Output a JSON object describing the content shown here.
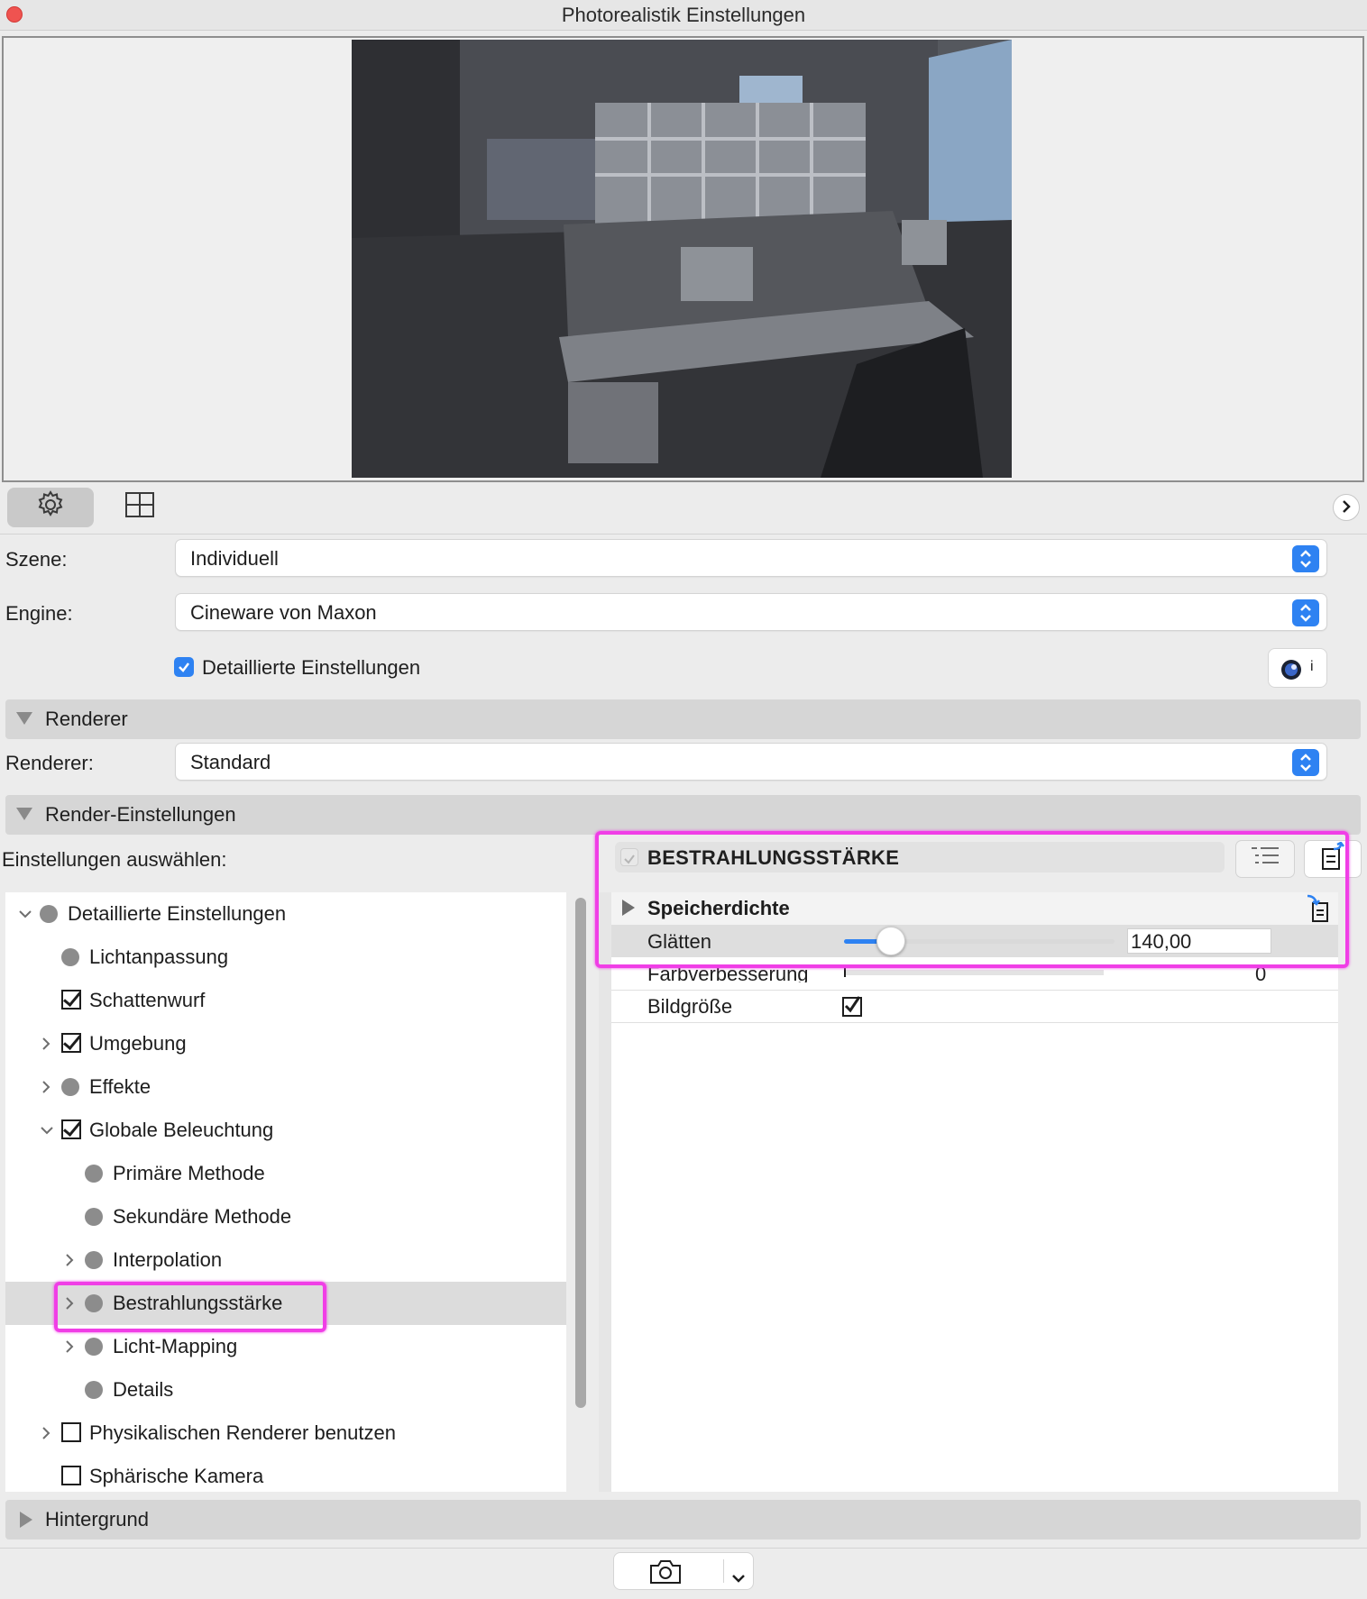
{
  "window": {
    "title": "Photorealistik Einstellungen"
  },
  "toolbar": {
    "settings_icon": "gear-icon",
    "layout_icon": "grid-frame-icon",
    "collapse_icon": "chevron-right-icon"
  },
  "form": {
    "scene_label": "Szene:",
    "scene_value": "Individuell",
    "engine_label": "Engine:",
    "engine_value": "Cineware von Maxon",
    "detailed_label": "Detaillierte Einstellungen",
    "detailed_checked": true,
    "info_button": "i"
  },
  "sections": {
    "renderer": "Renderer",
    "render_settings": "Render-Einstellungen",
    "background": "Hintergrund"
  },
  "renderer": {
    "label": "Renderer:",
    "value": "Standard"
  },
  "settings_select_label": "Einstellungen auswählen:",
  "tree": [
    {
      "label": "Detaillierte Einstellungen",
      "kind": "dot",
      "level": 0,
      "expander": "open"
    },
    {
      "label": "Lichtanpassung",
      "kind": "dot",
      "level": 1,
      "expander": "none"
    },
    {
      "label": "Schattenwurf",
      "kind": "checked",
      "level": 1,
      "expander": "none"
    },
    {
      "label": "Umgebung",
      "kind": "checked",
      "level": 1,
      "expander": "closed"
    },
    {
      "label": "Effekte",
      "kind": "dot",
      "level": 1,
      "expander": "closed"
    },
    {
      "label": "Globale Beleuchtung",
      "kind": "checked",
      "level": 1,
      "expander": "open"
    },
    {
      "label": "Primäre Methode",
      "kind": "dot",
      "level": 2,
      "expander": "none"
    },
    {
      "label": "Sekundäre Methode",
      "kind": "dot",
      "level": 2,
      "expander": "none"
    },
    {
      "label": "Interpolation",
      "kind": "dot",
      "level": 2,
      "expander": "closed"
    },
    {
      "label": "Bestrahlungsstärke",
      "kind": "dot",
      "level": 2,
      "expander": "closed",
      "selected": true
    },
    {
      "label": "Licht-Mapping",
      "kind": "dot",
      "level": 2,
      "expander": "closed"
    },
    {
      "label": "Details",
      "kind": "dot",
      "level": 2,
      "expander": "none"
    },
    {
      "label": "Physikalischen Renderer benutzen",
      "kind": "unchecked",
      "level": 1,
      "expander": "closed"
    },
    {
      "label": "Sphärische Kamera",
      "kind": "unchecked",
      "level": 1,
      "expander": "none"
    }
  ],
  "panel": {
    "header": "BESTRAHLUNGSSTÄRKE",
    "group": "Speicherdichte",
    "props": [
      {
        "label": "Glätten",
        "value": "140,00",
        "fraction": 0.15
      },
      {
        "label": "Farbverbesserung",
        "value": "0",
        "fraction": 0.0
      },
      {
        "label": "Bildgröße",
        "checked": true
      }
    ]
  },
  "bottom": {
    "render_icon": "camera-icon",
    "menu_icon": "chevron-down-icon"
  },
  "colors": {
    "accent": "#2e82f2",
    "highlight": "#f03ee6"
  }
}
